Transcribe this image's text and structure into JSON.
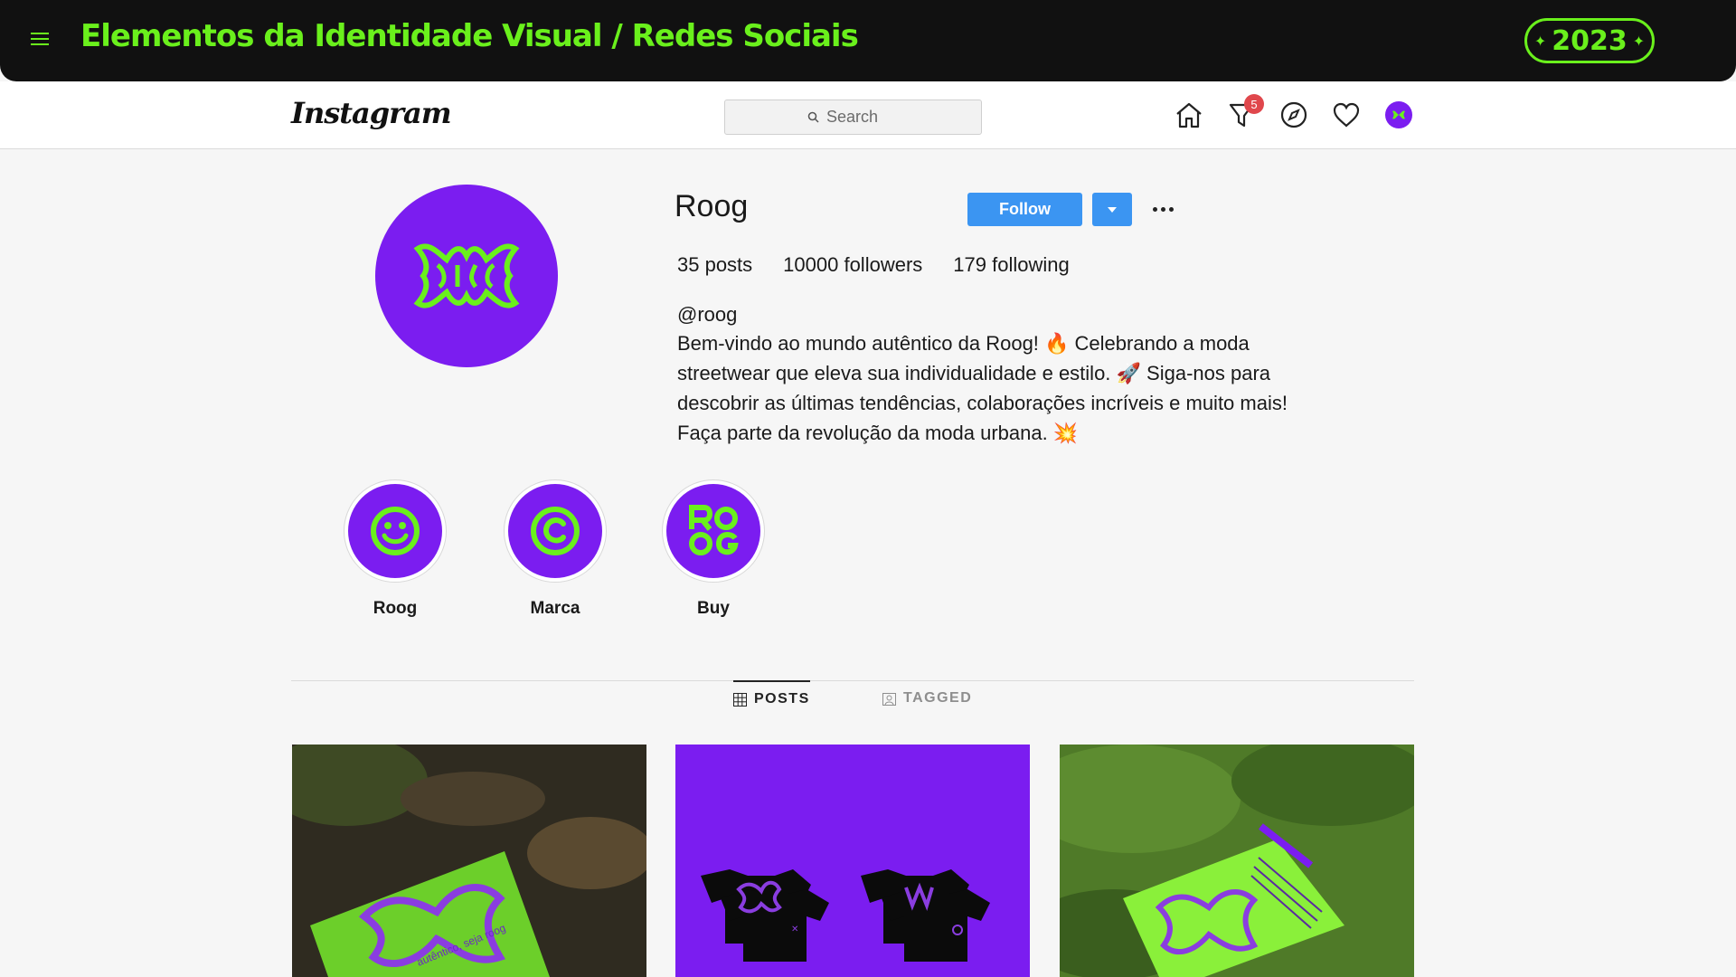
{
  "banner": {
    "title": "Elementos da Identidade Visual / Redes Sociais",
    "year": "2023",
    "accent_color": "#6af01c",
    "background_color": "#111111"
  },
  "nav": {
    "logo": "Instagram",
    "search_placeholder": "Search",
    "notification_count": "5",
    "icons": [
      "home-icon",
      "direct-filter-icon",
      "explore-compass-icon",
      "activity-heart-icon",
      "profile-avatar-icon"
    ]
  },
  "profile": {
    "username": "Roog",
    "follow_label": "Follow",
    "posts": "35 posts",
    "followers": "10000 followers",
    "following": "179 following",
    "handle": "@roog",
    "bio": "Bem-vindo ao mundo autêntico da Roog! 🔥 Celebrando a moda streetwear que eleva sua individualidade e estilo. 🚀 Siga-nos para descobrir as últimas tendências, colaborações incríveis e muito mais! Faça parte da revolução da moda urbana. 💥",
    "brand_color": "#7b1df0"
  },
  "highlights": [
    {
      "label": "Roog",
      "icon": "smiley-icon"
    },
    {
      "label": "Marca",
      "icon": "copyright-icon"
    },
    {
      "label": "Buy",
      "icon": "roog-logo-icon"
    }
  ],
  "tabs": {
    "posts": "POSTS",
    "tagged": "TAGGED"
  },
  "posts": [
    {
      "alt_icon": "poster-on-ground-photo",
      "caption_text": "autêntico, seja roog"
    },
    {
      "alt_icon": "tshirts-mockup-photo"
    },
    {
      "alt_icon": "poster-on-grass-photo"
    }
  ]
}
